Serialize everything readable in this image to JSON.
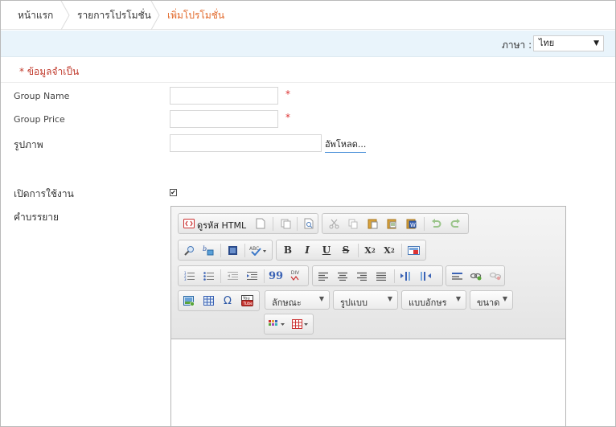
{
  "breadcrumb": {
    "items": [
      "หน้าแรก",
      "รายการโปรโมชั่น",
      "เพิ่มโปรโมชั่น"
    ]
  },
  "language": {
    "label": "ภาษา :",
    "selected": "ไทย"
  },
  "required_note": "* ข้อมูลจำเป็น",
  "form": {
    "group_name_label": "Group Name",
    "group_price_label": "Group Price",
    "image_label": "รูปภาพ",
    "upload_label": "อัพโหลด...",
    "enable_label": "เปิดการใช้งาน",
    "enable_checked": true,
    "description_label": "คำบรรยาย",
    "required_star": "*"
  },
  "editor": {
    "source_label": "ดูรหัส HTML",
    "bold": "B",
    "italic": "I",
    "underline": "U",
    "strike": "S",
    "subscript": "X",
    "subscript_mark": "2",
    "superscript": "X",
    "superscript_mark": "2",
    "blockquote": "99",
    "div": "DIV",
    "combos": [
      "ลักษณะ",
      "รูปแบบ",
      "แบบอักษร",
      "ขนาด"
    ]
  },
  "colors": {
    "accent": "#e26a2c",
    "required": "#c0392b",
    "langbar": "#e9f4fb"
  }
}
